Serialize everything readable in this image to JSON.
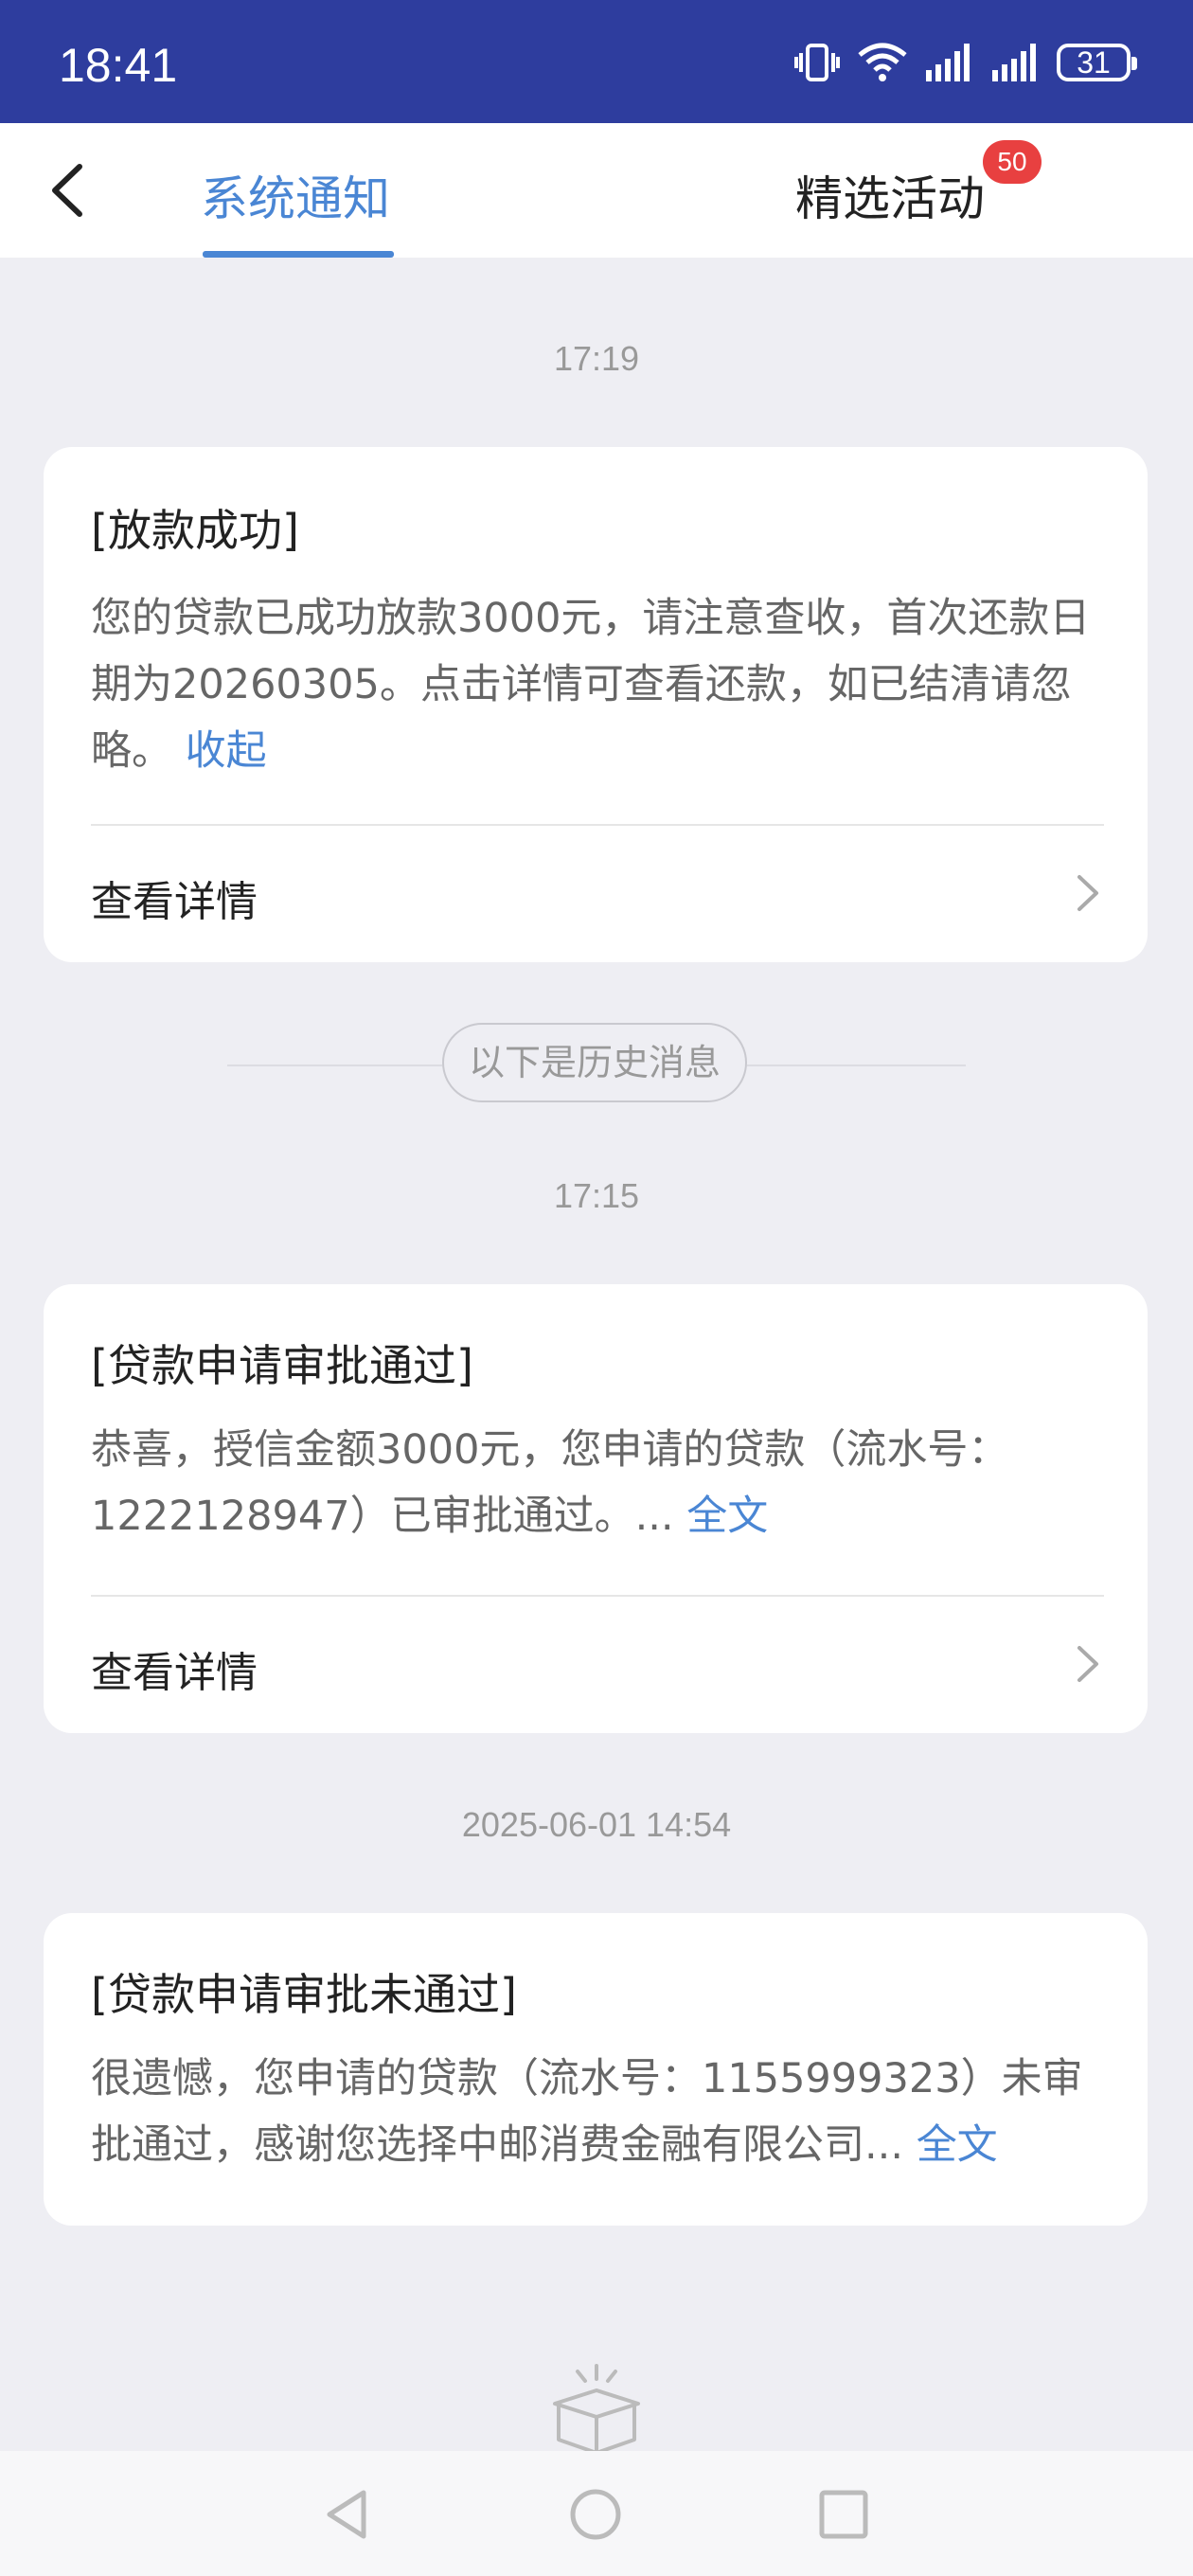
{
  "status_bar": {
    "time": "18:41",
    "battery": "31"
  },
  "header": {
    "tabs": [
      {
        "label": "系统通知"
      },
      {
        "label": "精选活动",
        "badge": "50"
      }
    ],
    "accent_color": "#4a86d4"
  },
  "messages": [
    {
      "time": "17:19",
      "title": "[放款成功]",
      "body": "您的贷款已成功放款3000元，请注意查收，首次还款日期为20260305。点击详情可查看还款，如已结清请忽略。",
      "link_label": "收起",
      "detail_label": "查看详情"
    },
    {
      "time": "17:15",
      "title": "[贷款申请审批通过]",
      "body": "恭喜，授信金额3000元，您申请的贷款（流水号：1222128947）已审批通过。...",
      "link_label": "全文",
      "detail_label": "查看详情"
    },
    {
      "time": "2025-06-01 14:54",
      "title": "[贷款申请审批未通过]",
      "body": "很遗憾，您申请的贷款（流水号：1155999323）未审批通过，感谢您选择中邮消费金融有限公司...",
      "link_label": "全文"
    }
  ],
  "history_separator": "以下是历史消息",
  "icons": {
    "back": "chevron-left-icon",
    "detail": "chevron-right-icon",
    "empty": "empty-box-icon",
    "nav": [
      "nav-back-icon",
      "nav-home-icon",
      "nav-recents-icon"
    ]
  }
}
